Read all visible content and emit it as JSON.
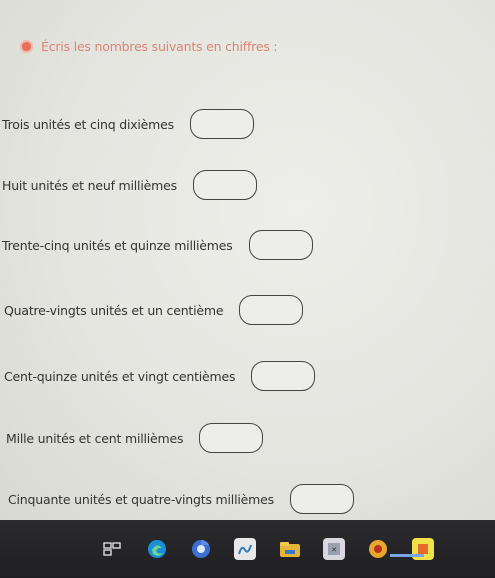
{
  "instruction": {
    "text": "Écris les nombres suivants en chiffres :"
  },
  "questions": [
    {
      "label": "Trois unités et cinq dixièmes",
      "answer": ""
    },
    {
      "label": "Huit unités et neuf millièmes",
      "answer": ""
    },
    {
      "label": "Trente-cinq unités et quinze millièmes",
      "answer": ""
    },
    {
      "label": "Quatre-vingts unités et un centième",
      "answer": ""
    },
    {
      "label": "Cent-quinze unités et vingt centièmes",
      "answer": ""
    },
    {
      "label": "Mille unités et cent millièmes",
      "answer": ""
    },
    {
      "label": "Cinquante unités et quatre-vingts millièmes",
      "answer": ""
    }
  ],
  "taskbar": {
    "icons": [
      "task-view-icon",
      "edge-icon",
      "chrome-icon",
      "pen-app-icon",
      "explorer-icon",
      "media-app-icon",
      "record-app-icon",
      "app-icon"
    ]
  },
  "colors": {
    "instruction_text": "#d98573",
    "bullet": "#e76f5a",
    "taskbar": "#232326"
  }
}
